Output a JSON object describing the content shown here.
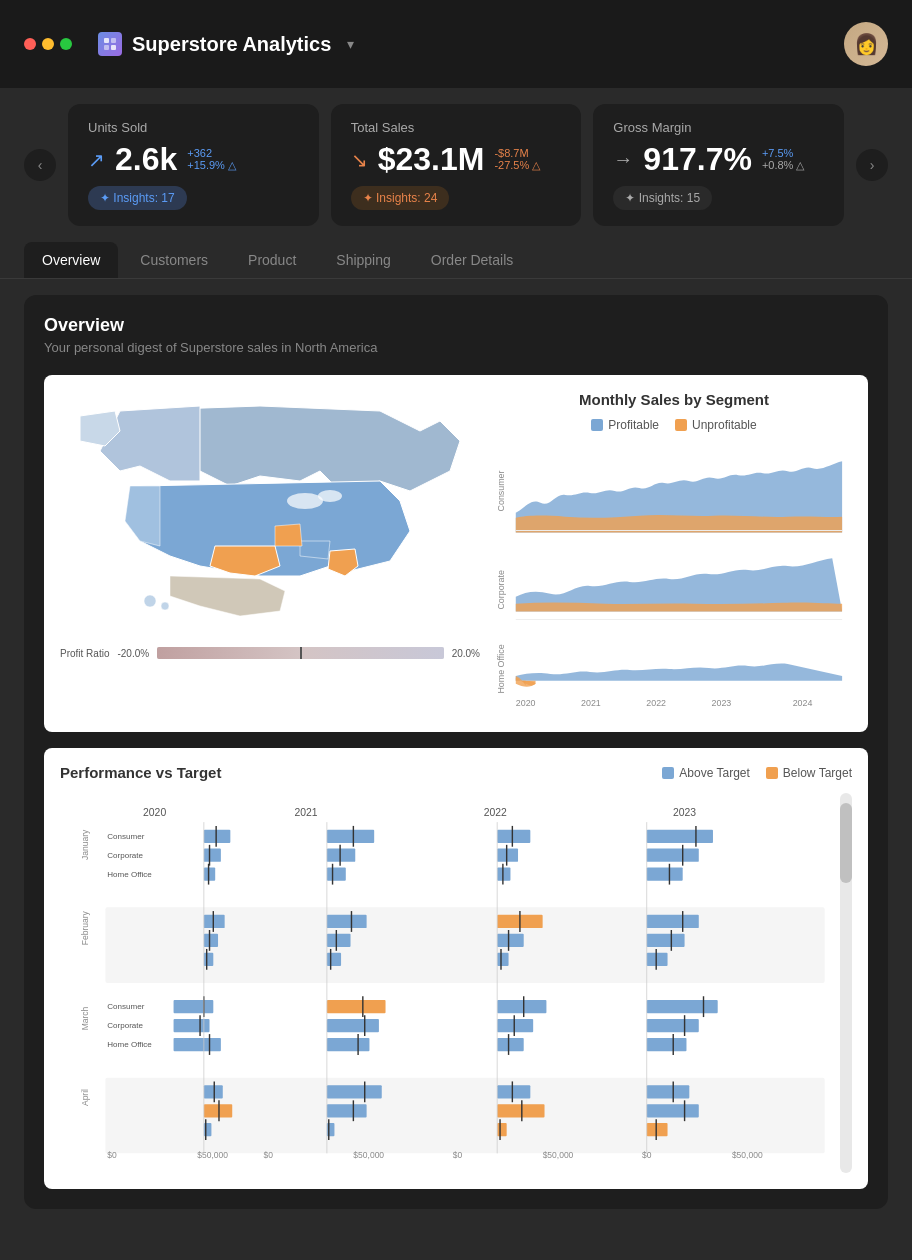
{
  "app": {
    "title": "Superstore Analytics",
    "dropdown_symbol": "▾"
  },
  "traffic_lights": [
    "red",
    "yellow",
    "green"
  ],
  "tabs": [
    {
      "label": "Overview",
      "active": true
    },
    {
      "label": "Customers",
      "active": false
    },
    {
      "label": "Product",
      "active": false
    },
    {
      "label": "Shipping",
      "active": false
    },
    {
      "label": "Order Details",
      "active": false
    }
  ],
  "kpi_cards": [
    {
      "label": "Units Sold",
      "arrow": "↗",
      "arrow_type": "up",
      "value": "2.6k",
      "delta1": "+362",
      "delta1_class": "pos",
      "delta2": "+15.9% △",
      "delta2_class": "pos",
      "insights_label": "✦ Insights: 17",
      "insights_class": "blue"
    },
    {
      "label": "Total Sales",
      "arrow": "↘",
      "arrow_type": "down",
      "value": "$23.1M",
      "delta1": "-$8.7M",
      "delta1_class": "neg",
      "delta2": "-27.5% △",
      "delta2_class": "neg",
      "insights_label": "✦ Insights: 24",
      "insights_class": "orange"
    },
    {
      "label": "Gross Margin",
      "arrow": "→",
      "arrow_type": "right",
      "value": "917.7%",
      "delta1": "+7.5%",
      "delta1_class": "pos",
      "delta2": "+0.8% △",
      "delta2_class": "neutral",
      "insights_label": "✦ Insights: 15",
      "insights_class": "gray"
    }
  ],
  "overview": {
    "title": "Overview",
    "subtitle": "Your personal digest of Superstore sales in North America"
  },
  "monthly_chart": {
    "title": "Monthly Sales by Segment",
    "legend_profitable": "Profitable",
    "legend_unprofitable": "Unprofitable",
    "segments": [
      "Consumer",
      "Corporate",
      "Home Office"
    ],
    "years": [
      "2020",
      "2021",
      "2022",
      "2023",
      "2024"
    ]
  },
  "profit_ratio": {
    "label": "Profit Ratio",
    "min": "-20.0%",
    "max": "20.0%"
  },
  "performance": {
    "title": "Performance vs Target",
    "legend_above": "Above Target",
    "legend_below": "Below Target",
    "years": [
      "2020",
      "2021",
      "2022",
      "2023"
    ],
    "months": [
      "January",
      "February",
      "March",
      "April"
    ],
    "segments": [
      "Consumer",
      "Corporate",
      "Home Office"
    ],
    "x_labels": [
      "$0",
      "$50,000",
      "$0",
      "$50,000",
      "$0",
      "$50,000",
      "$0",
      "$50,000"
    ]
  }
}
